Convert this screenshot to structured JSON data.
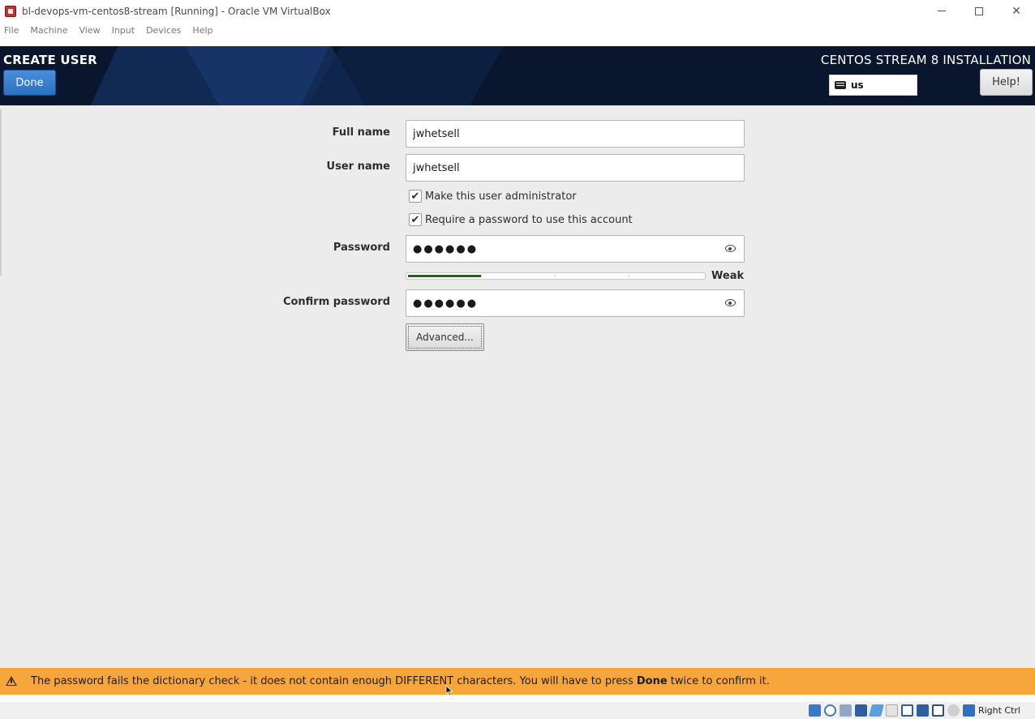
{
  "window": {
    "title": "bl-devops-vm-centos8-stream [Running] - Oracle VM VirtualBox",
    "minimize_glyph": "—",
    "close_glyph": "✕"
  },
  "menubar": {
    "items": [
      "File",
      "Machine",
      "View",
      "Input",
      "Devices",
      "Help"
    ]
  },
  "header": {
    "spoke_title": "CREATE USER",
    "done_label": "Done",
    "product_title": "CENTOS STREAM 8 INSTALLATION",
    "keyboard_layout": "us",
    "help_label": "Help!"
  },
  "form": {
    "full_name_label": "Full name",
    "full_name_value": "jwhetsell",
    "user_name_label": "User name",
    "user_name_value": "jwhetsell",
    "admin_checkbox_label": "Make this user administrator",
    "admin_checked": true,
    "require_password_label": "Require a password to use this account",
    "require_password_checked": true,
    "password_label": "Password",
    "password_mask": "●●●●●●",
    "strength_label": "Weak",
    "strength_fraction": 0.25,
    "strength_color": "#196b13",
    "confirm_label": "Confirm password",
    "confirm_mask": "●●●●●●",
    "advanced_label": "Advanced..."
  },
  "warning": {
    "text_before": "The password fails the dictionary check - it does not contain enough DIFFERENT characters. You will have to press ",
    "text_bold": "Done",
    "text_after": " twice to confirm it.",
    "color": "#f6a63a"
  },
  "statusbar": {
    "host_key": "Right Ctrl",
    "icons": [
      "hard-disk-icon",
      "optical-drive-icon",
      "audio-icon",
      "network-icon",
      "usb-icon",
      "shared-folders-icon",
      "display-icon",
      "video-capture-icon",
      "virtualization-icon",
      "mouse-integration-icon",
      "keyboard-capture-icon"
    ]
  }
}
